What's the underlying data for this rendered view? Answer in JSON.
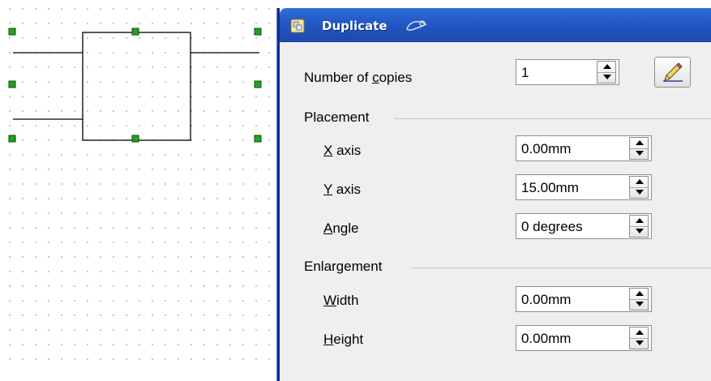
{
  "dialog": {
    "title": "Duplicate",
    "copies": {
      "label": "Number of copies",
      "mnemonic": "c",
      "value": "1"
    },
    "pick_button_icon": "pencil-pipette-icon",
    "placement": {
      "heading": "Placement",
      "x_axis": {
        "label": "X axis",
        "value": "0.00mm"
      },
      "y_axis": {
        "label": "Y axis",
        "value": "15.00mm"
      },
      "angle": {
        "label": "Angle",
        "value": "0 degrees"
      }
    },
    "enlargement": {
      "heading": "Enlargement",
      "width": {
        "label": "Width",
        "value": "0.00mm"
      },
      "height": {
        "label": "Height",
        "value": "0.00mm"
      }
    }
  },
  "colors": {
    "titlebar": "#2459c6",
    "handle": "#22a322",
    "dialog_bg": "#efefef"
  }
}
